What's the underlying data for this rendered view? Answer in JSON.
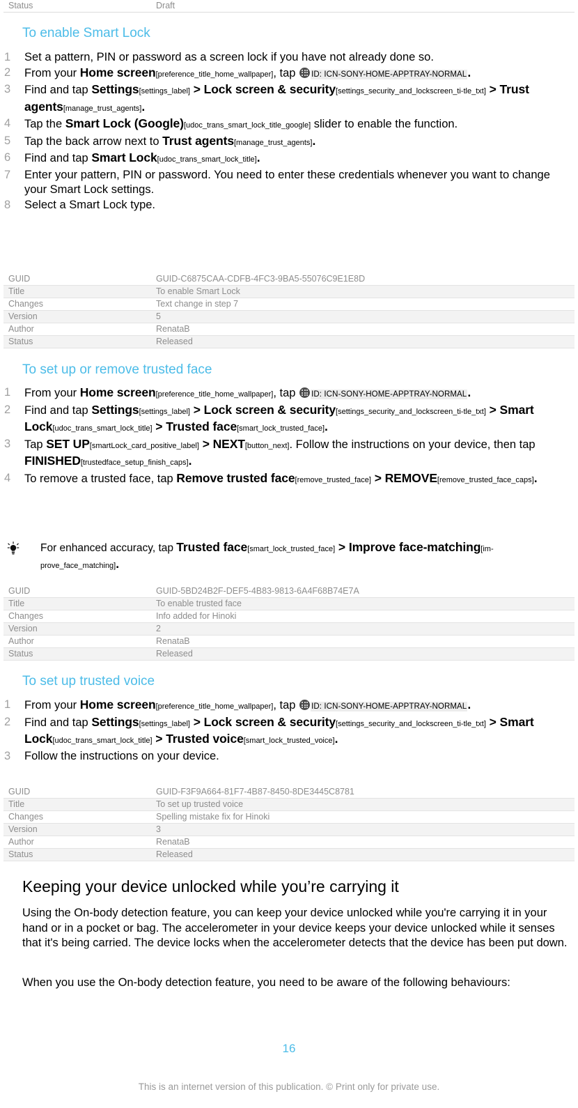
{
  "top_meta_row": {
    "key": "Status",
    "value": "Draft"
  },
  "sections": [
    {
      "id": "enable-smart-lock",
      "heading": "To enable Smart Lock",
      "steps": [
        {
          "num": "1",
          "text": "Set a pattern, PIN or password as a screen lock if you have not already done so."
        },
        {
          "num": "2",
          "prefix": "From your ",
          "ui1": "Home screen",
          "tok1": "[preference_title_home_wallpaper]",
          "mid": ", tap ",
          "icon": "apptray-icon",
          "id_token": "ID: ICN-SONY-HOME-APPTRAY-NORMAL",
          "suffix": "."
        },
        {
          "num": "3",
          "prefix": "Find and tap ",
          "ui1": "Settings",
          "tok1": "[settings_label]",
          "sep1": " > ",
          "ui2": "Lock screen & security",
          "tok2": "[settings_security_and_lockscreen_ti-tle_txt]",
          "sep2": " > ",
          "ui3": "Trust agents",
          "tok3": "[manage_trust_agents]",
          "suffix": "."
        },
        {
          "num": "4",
          "prefix": "Tap the ",
          "ui1": "Smart Lock (Google)",
          "tok1": "[udoc_trans_smart_lock_title_google]",
          "suffix_plain": " slider to enable the function."
        },
        {
          "num": "5",
          "prefix": "Tap the back arrow next to ",
          "ui1": "Trust agents",
          "tok1": "[manage_trust_agents]",
          "suffix": "."
        },
        {
          "num": "6",
          "prefix": "Find and tap ",
          "ui1": "Smart Lock",
          "tok1": "[udoc_trans_smart_lock_title]",
          "suffix": "."
        },
        {
          "num": "7",
          "text": "Enter your pattern, PIN or password. You need to enter these credentials whenever you want to change your Smart Lock settings."
        },
        {
          "num": "8",
          "text": "Select a Smart Lock type."
        }
      ],
      "meta": {
        "rows": [
          {
            "key": "GUID",
            "value": "GUID-C6875CAA-CDFB-4FC3-9BA5-55076C9E1E8D"
          },
          {
            "key": "Title",
            "value": "To enable Smart Lock"
          },
          {
            "key": "Changes",
            "value": "Text change in step 7"
          },
          {
            "key": "Version",
            "value": "5"
          },
          {
            "key": "Author",
            "value": "RenataB"
          },
          {
            "key": "Status",
            "value": "Released"
          }
        ]
      }
    },
    {
      "id": "trusted-face",
      "heading": "To set up or remove trusted face",
      "steps": [
        {
          "num": "1",
          "prefix": "From your ",
          "ui1": "Home screen",
          "tok1": "[preference_title_home_wallpaper]",
          "mid": ", tap ",
          "icon": "apptray-icon",
          "id_token": "ID: ICN-SONY-HOME-APPTRAY-NORMAL",
          "suffix": "."
        },
        {
          "num": "2",
          "prefix": "Find and tap ",
          "ui1": "Settings",
          "tok1": "[settings_label]",
          "sep1": " > ",
          "ui2": "Lock screen & security",
          "tok2": "[settings_security_and_lockscreen_ti-tle_txt]",
          "sep2": " > ",
          "ui3": "Smart Lock",
          "tok3": "[udoc_trans_smart_lock_title]",
          "sep3": " > ",
          "ui4": "Trusted face",
          "tok4": "[smart_lock_trusted_face]",
          "suffix": "."
        },
        {
          "num": "3",
          "prefix": "Tap ",
          "ui1": "SET UP",
          "tok1": "[smartLock_card_positive_label]",
          "sep1": " > ",
          "ui2": "NEXT",
          "tok2": "[button_next]",
          "mid2": ". Follow the instructions on your device, then tap ",
          "ui3": "FINISHED",
          "tok3": "[trustedface_setup_finish_caps]",
          "suffix": "."
        },
        {
          "num": "4",
          "prefix": "To remove a trusted face, tap ",
          "ui1": "Remove trusted face",
          "tok1": "[remove_trusted_face]",
          "sep1": " > ",
          "ui2": "REMOVE",
          "tok2": "[remove_trusted_face_caps]",
          "suffix": "."
        }
      ],
      "tip": {
        "prefix": "For enhanced accuracy, tap ",
        "ui1": "Trusted face",
        "tok1": "[smart_lock_trusted_face]",
        "sep1": " > ",
        "ui2": "Improve face-matching",
        "tok2": "[im-prove_face_matching]",
        "suffix": "."
      },
      "meta": {
        "rows": [
          {
            "key": "GUID",
            "value": "GUID-5BD24B2F-DEF5-4B83-9813-6A4F68B74E7A"
          },
          {
            "key": "Title",
            "value": "To enable trusted face"
          },
          {
            "key": "Changes",
            "value": "Info added for Hinoki"
          },
          {
            "key": "Version",
            "value": "2"
          },
          {
            "key": "Author",
            "value": "RenataB"
          },
          {
            "key": "Status",
            "value": "Released"
          }
        ]
      }
    },
    {
      "id": "trusted-voice",
      "heading": "To set up trusted voice",
      "steps": [
        {
          "num": "1",
          "prefix": "From your ",
          "ui1": "Home screen",
          "tok1": "[preference_title_home_wallpaper]",
          "mid": ", tap ",
          "icon": "apptray-icon",
          "id_token": "ID: ICN-SONY-HOME-APPTRAY-NORMAL",
          "suffix": "."
        },
        {
          "num": "2",
          "prefix": "Find and tap ",
          "ui1": "Settings",
          "tok1": "[settings_label]",
          "sep1": " > ",
          "ui2": "Lock screen & security",
          "tok2": "[settings_security_and_lockscreen_ti-tle_txt]",
          "sep2": " > ",
          "ui3": "Smart Lock",
          "tok3": "[udoc_trans_smart_lock_title]",
          "sep3": " > ",
          "ui4": "Trusted voice",
          "tok4": "[smart_lock_trusted_voice]",
          "suffix": "."
        },
        {
          "num": "3",
          "text": "Follow the instructions on your device."
        }
      ],
      "meta": {
        "rows": [
          {
            "key": "GUID",
            "value": "GUID-F3F9A664-81F7-4B87-8450-8DE3445C8781"
          },
          {
            "key": "Title",
            "value": "To set up trusted voice"
          },
          {
            "key": "Changes",
            "value": "Spelling mistake fix for Hinoki"
          },
          {
            "key": "Version",
            "value": "3"
          },
          {
            "key": "Author",
            "value": "RenataB"
          },
          {
            "key": "Status",
            "value": "Released"
          }
        ]
      }
    }
  ],
  "article": {
    "heading": "Keeping your device unlocked while you’re carrying it",
    "paragraphs": [
      "Using the On-body detection feature, you can keep your device unlocked while you're carrying it in your hand or in a pocket or bag. The accelerometer in your device keeps your device unlocked while it senses that it's being carried. The device locks when the accelerometer detects that the device has been put down.",
      "When you use the On-body detection feature, you need to be aware of the following behaviours:"
    ]
  },
  "footer": {
    "page_number": "16",
    "notice": "This is an internet version of this publication. © Print only for private use."
  },
  "colors": {
    "heading_blue": "#4cbce8",
    "step_number_gray": "#a0a0a0",
    "meta_text_gray": "#8d8d8d",
    "meta_row_alt": "#f3f3f3",
    "token_highlight": "#ececec",
    "icon_dark": "#4c4c4c"
  }
}
